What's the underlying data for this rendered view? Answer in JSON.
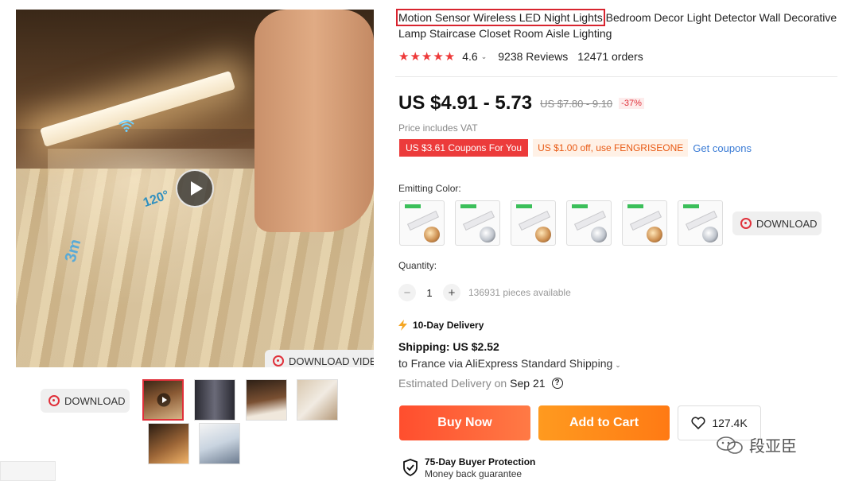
{
  "product": {
    "title_highlight": "Motion Sensor Wireless LED Night Lights",
    "title_rest": " Bedroom Decor Light Detector Wall Decorative Lamp Staircase Closet Room Aisle Lighting",
    "rating": "4.6",
    "stars": "★★★★★",
    "reviews": "9238 Reviews",
    "orders": "12471 orders"
  },
  "media": {
    "angle_label": "120°",
    "distance_label": "3m",
    "download_video_label": "DOWNLOAD VIDEO",
    "download_label": "DOWNLOAD",
    "thumbnail_count": 6
  },
  "price": {
    "current": "US $4.91 - 5.73",
    "original": "US $7.80 - 9.10",
    "discount": "-37%",
    "vat_note": "Price includes VAT"
  },
  "coupons": {
    "coupon_red": "US $3.61 Coupons For You",
    "coupon_orange": "US $1.00 off, use FENGRISEONE",
    "get_coupons": "Get coupons"
  },
  "variants": {
    "label": "Emitting Color:",
    "download_label": "DOWNLOAD"
  },
  "quantity": {
    "label": "Quantity:",
    "value": "1",
    "minus": "−",
    "plus": "+",
    "available": "136931 pieces available"
  },
  "shipping": {
    "badge": "10-Day Delivery",
    "cost": "Shipping: US $2.52",
    "route": "to France via AliExpress Standard Shipping",
    "estimated_label": "Estimated Delivery on",
    "estimated_date": "Sep 21",
    "help": "?"
  },
  "actions": {
    "buy_now": "Buy Now",
    "add_to_cart": "Add to Cart",
    "wishlist_count": "127.4K"
  },
  "protection": {
    "title": "75-Day Buyer Protection",
    "subtitle": "Money back guarantee"
  },
  "watermark": {
    "text": "段亚臣"
  },
  "colors": {
    "accent_red": "#e0303a",
    "buy_now": "#ff4e2e",
    "add_to_cart": "#ff9a1f",
    "link_blue": "#3a7bd5",
    "star": "#ee3a3a"
  }
}
